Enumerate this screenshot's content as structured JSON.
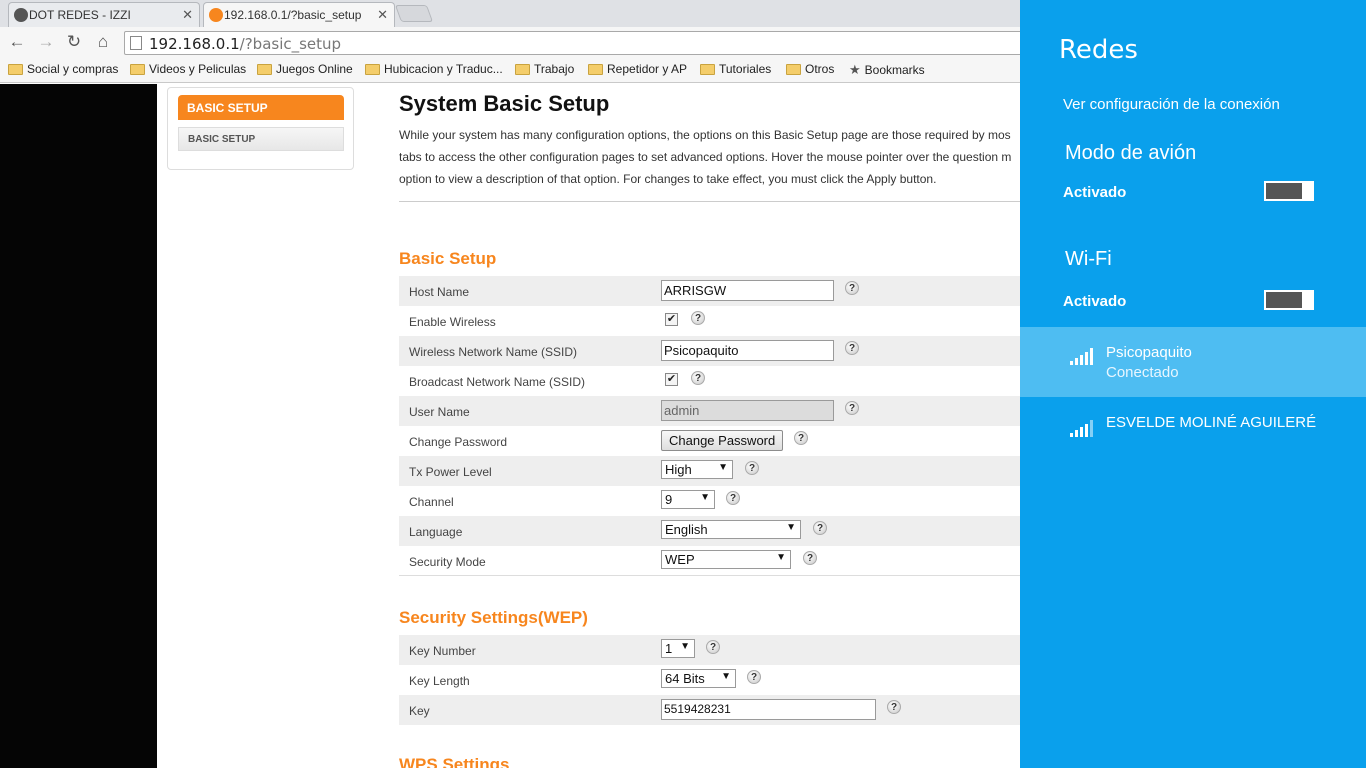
{
  "browser": {
    "tabs": [
      {
        "title": "DOT REDES - IZZI",
        "active": false
      },
      {
        "title": "192.168.0.1/?basic_setup",
        "active": true
      }
    ],
    "url_host": "192.168.0.1",
    "url_path": "/?basic_setup",
    "bookmarks": [
      "Social y compras",
      "Videos y Peliculas",
      "Juegos Online",
      "Hubicacion y Traduc...",
      "Trabajo",
      "Repetidor y AP",
      "Tutoriales",
      "Otros",
      "Bookmarks"
    ]
  },
  "sidebar": {
    "header": "BASIC SETUP",
    "item": "BASIC SETUP"
  },
  "page": {
    "title": "System Basic Setup",
    "intro_lines": [
      "While your system has many configuration options, the options on this Basic Setup page are those required by mos",
      "tabs to access the other configuration pages to set advanced options. Hover the mouse pointer over the question m",
      "option to view a description of that option. For changes to take effect, you must click the Apply button."
    ],
    "basic_setup": {
      "heading": "Basic Setup",
      "host_name_label": "Host Name",
      "host_name_value": "ARRISGW",
      "enable_wireless_label": "Enable Wireless",
      "enable_wireless_checked": true,
      "ssid_label": "Wireless Network Name (SSID)",
      "ssid_value": "Psicopaquito",
      "broadcast_label": "Broadcast Network Name (SSID)",
      "broadcast_checked": true,
      "user_name_label": "User Name",
      "user_name_value": "admin",
      "change_password_label": "Change Password",
      "change_password_button": "Change Password",
      "tx_power_label": "Tx Power Level",
      "tx_power_value": "High",
      "channel_label": "Channel",
      "channel_value": "9",
      "language_label": "Language",
      "language_value": "English",
      "security_mode_label": "Security Mode",
      "security_mode_value": "WEP"
    },
    "security_settings": {
      "heading": "Security Settings(WEP)",
      "key_number_label": "Key Number",
      "key_number_value": "1",
      "key_length_label": "Key Length",
      "key_length_value": "64 Bits",
      "key_label": "Key",
      "key_value": "5519428231"
    },
    "wps_heading": "WPS Settings",
    "help_glyph": "?",
    "check_glyph": "✔",
    "dropdown_glyph": "▼"
  },
  "charm": {
    "title": "Redes",
    "view_settings_link": "Ver configuración de la conexión",
    "airplane_heading": "Modo de avión",
    "airplane_state": "Activado",
    "wifi_heading": "Wi-Fi",
    "wifi_state": "Activado",
    "networks": [
      {
        "name": "Psicopaquito",
        "status": "Conectado",
        "selected": true
      },
      {
        "name": "ESVELDE MOLINÉ AGUILERÉ",
        "status": "",
        "selected": false
      }
    ]
  },
  "colors": {
    "accent_orange": "#f7861e",
    "charm_blue": "#0aa0ec",
    "charm_selected": "#4ebdf2"
  }
}
